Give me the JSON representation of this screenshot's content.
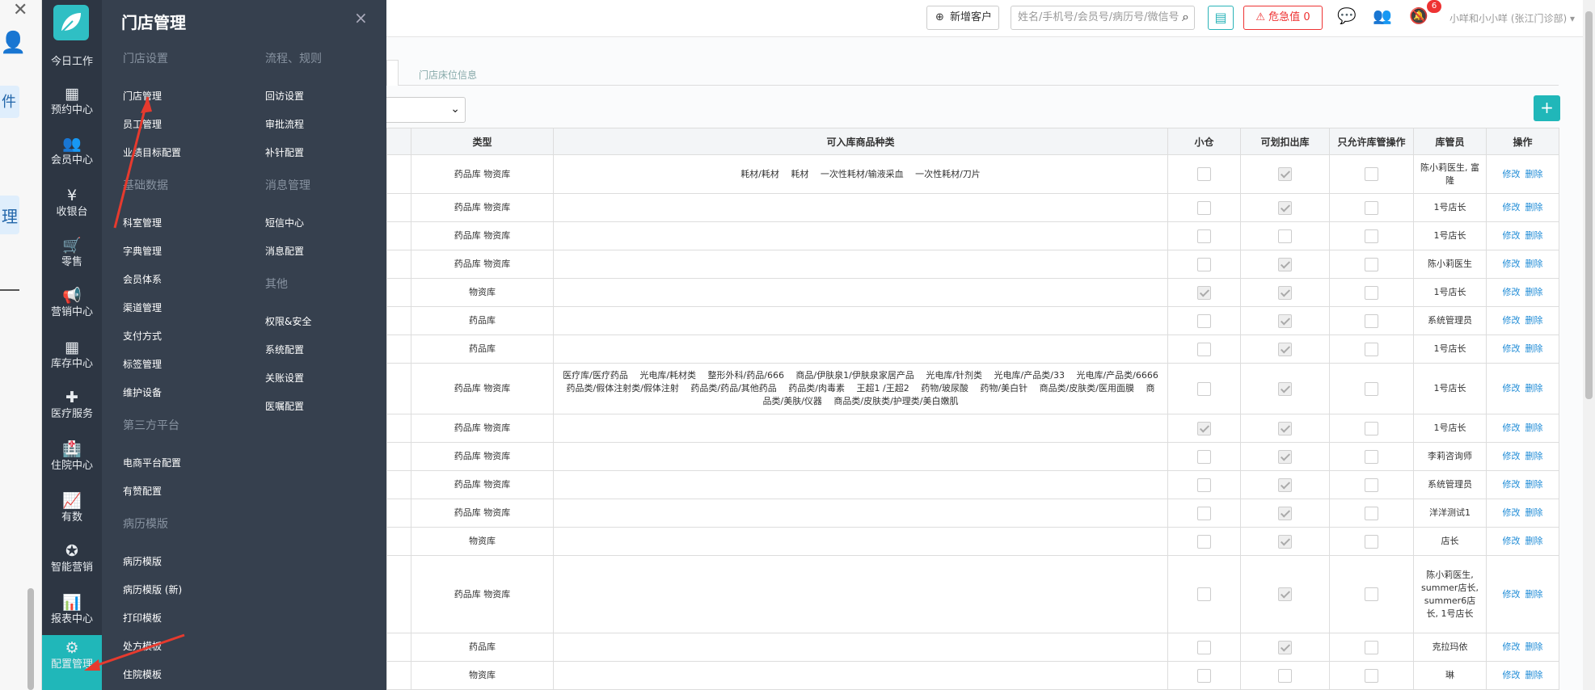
{
  "left_strip": {
    "close_glyph": "✕",
    "person_glyph": "👤",
    "fragment1": "件",
    "fragment2": "理"
  },
  "nav": [
    {
      "label": "今日工作",
      "icon": ""
    },
    {
      "label": "预约中心",
      "icon": "▦"
    },
    {
      "label": "会员中心",
      "icon": "👥"
    },
    {
      "label": "收银台",
      "icon": "¥"
    },
    {
      "label": "零售",
      "icon": "🛒"
    },
    {
      "label": "营销中心",
      "icon": "📢"
    },
    {
      "label": "库存中心",
      "icon": "▦"
    },
    {
      "label": "医疗服务",
      "icon": "✚"
    },
    {
      "label": "住院中心",
      "icon": "🏥"
    },
    {
      "label": "有数",
      "icon": "📈"
    },
    {
      "label": "智能营销",
      "icon": "✪"
    },
    {
      "label": "报表中心",
      "icon": "📊"
    },
    {
      "label": "配置管理",
      "icon": "⚙"
    }
  ],
  "submenu": {
    "title": "门店管理",
    "close": "×",
    "left_col": [
      {
        "type": "h",
        "text": "门店设置"
      },
      {
        "type": "i",
        "text": "门店管理"
      },
      {
        "type": "i",
        "text": "员工管理"
      },
      {
        "type": "i",
        "text": "业绩目标配置"
      },
      {
        "type": "h",
        "text": "基础数据"
      },
      {
        "type": "i",
        "text": "科室管理"
      },
      {
        "type": "i",
        "text": "字典管理"
      },
      {
        "type": "i",
        "text": "会员体系"
      },
      {
        "type": "i",
        "text": "渠道管理"
      },
      {
        "type": "i",
        "text": "支付方式"
      },
      {
        "type": "i",
        "text": "标签管理"
      },
      {
        "type": "i",
        "text": "维护设备"
      },
      {
        "type": "h",
        "text": "第三方平台"
      },
      {
        "type": "i",
        "text": "电商平台配置"
      },
      {
        "type": "i",
        "text": "有赞配置"
      },
      {
        "type": "h",
        "text": "病历模版"
      },
      {
        "type": "i",
        "text": "病历模版"
      },
      {
        "type": "i",
        "text": "病历模版 (新)"
      },
      {
        "type": "i",
        "text": "打印模板"
      },
      {
        "type": "i",
        "text": "处方模板"
      },
      {
        "type": "i",
        "text": "住院模板"
      }
    ],
    "right_col": [
      {
        "type": "h",
        "text": "流程、规则"
      },
      {
        "type": "i",
        "text": "回访设置"
      },
      {
        "type": "i",
        "text": "审批流程"
      },
      {
        "type": "i",
        "text": "补针配置"
      },
      {
        "type": "h",
        "text": "消息管理"
      },
      {
        "type": "i",
        "text": "短信中心"
      },
      {
        "type": "i",
        "text": "消息配置"
      },
      {
        "type": "h",
        "text": "其他"
      },
      {
        "type": "i",
        "text": "权限&安全"
      },
      {
        "type": "i",
        "text": "系统配置"
      },
      {
        "type": "i",
        "text": "关账设置"
      },
      {
        "type": "i",
        "text": "医嘱配置"
      }
    ]
  },
  "header": {
    "new_customer": "新增客户",
    "search_placeholder": "姓名/手机号/会员号/病历号/微信号",
    "danger_label": "危急值",
    "danger_count": "0",
    "badge": "6",
    "user": "小咩和小小咩 (张江门诊部) ▾"
  },
  "tabs": {
    "tab2": "门店床位信息"
  },
  "table": {
    "headers": [
      "类型",
      "可入库商品种类",
      "小仓",
      "可划扣出库",
      "只允许库管操作",
      "库管员",
      "操作"
    ],
    "edit": "修改",
    "delete": "删除",
    "rows": [
      {
        "type": "药品库 物资库",
        "goods": "耗材/耗材　 耗材　 一次性耗材/输液采血　 一次性耗材/刀片",
        "small": false,
        "deduct": true,
        "only": false,
        "keeper": "陈小莉医生, 富隆"
      },
      {
        "type": "药品库 物资库",
        "goods": "",
        "small": false,
        "deduct": true,
        "only": false,
        "keeper": "1号店长"
      },
      {
        "type": "药品库 物资库",
        "goods": "",
        "small": false,
        "deduct": false,
        "only": false,
        "keeper": "1号店长"
      },
      {
        "type": "药品库 物资库",
        "goods": "",
        "small": false,
        "deduct": true,
        "only": false,
        "keeper": "陈小莉医生"
      },
      {
        "type": "物资库",
        "goods": "",
        "small": true,
        "deduct": true,
        "only": false,
        "keeper": "1号店长"
      },
      {
        "type": "药品库",
        "goods": "",
        "small": false,
        "deduct": true,
        "only": false,
        "keeper": "系统管理员"
      },
      {
        "type": "药品库",
        "goods": "",
        "small": false,
        "deduct": true,
        "only": false,
        "keeper": "1号店长"
      },
      {
        "type": "药品库 物资库",
        "goods": "医疗库/医疗药品　 光电库/耗材类　 整形外科/药品/666　 商品/伊肤泉1/伊肤泉家居产品　 光电库/针剂类　 光电库/产品类/33　 光电库/产品类/6666　 药品类/假体注射类/假体注射　 药品类/药品/其他药品　 药品类/肉毒素　 王超1 /王超2　 药物/玻尿酸　 药物/美白针　 商品类/皮肤类/医用面膜　 商品类/美肤/仪器　 商品类/皮肤类/护理类/美白嫩肌",
        "small": false,
        "deduct": true,
        "only": false,
        "keeper": "1号店长"
      },
      {
        "type": "药品库 物资库",
        "goods": "",
        "small": true,
        "deduct": true,
        "only": false,
        "keeper": "1号店长"
      },
      {
        "type": "药品库 物资库",
        "goods": "",
        "small": false,
        "deduct": true,
        "only": false,
        "keeper": "李莉咨询师"
      },
      {
        "type": "药品库 物资库",
        "goods": "",
        "small": false,
        "deduct": true,
        "only": false,
        "keeper": "系统管理员"
      },
      {
        "type": "药品库 物资库",
        "goods": "",
        "small": false,
        "deduct": true,
        "only": false,
        "keeper": "洋洋测试1"
      },
      {
        "type": "物资库",
        "goods": "",
        "small": false,
        "deduct": true,
        "only": false,
        "keeper": "店长"
      },
      {
        "type": "药品库 物资库",
        "goods": "",
        "small": false,
        "deduct": true,
        "only": false,
        "keeper": "陈小莉医生, summer店长, summer6店长, 1号店长"
      },
      {
        "type": "药品库",
        "goods": "",
        "small": false,
        "deduct": true,
        "only": false,
        "keeper": "克拉玛依"
      },
      {
        "type": "物资库",
        "goods": "",
        "small": false,
        "deduct": false,
        "only": false,
        "keeper": "琳"
      }
    ]
  }
}
